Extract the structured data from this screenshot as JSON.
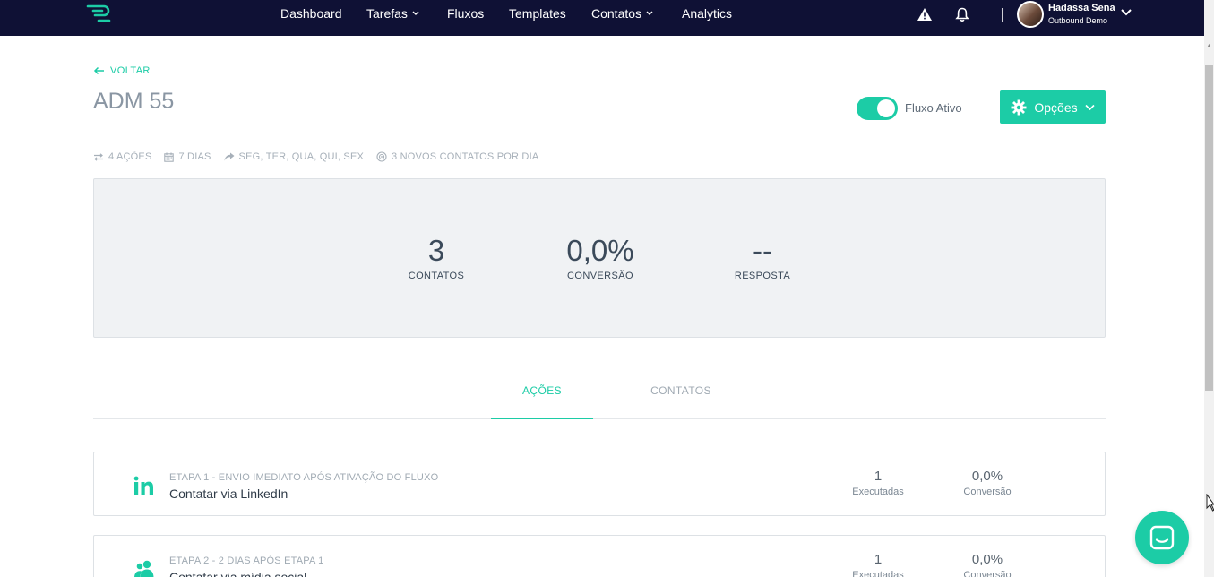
{
  "nav": {
    "items": [
      {
        "label": "Dashboard",
        "has_dropdown": false
      },
      {
        "label": "Tarefas",
        "has_dropdown": true
      },
      {
        "label": "Fluxos",
        "has_dropdown": false
      },
      {
        "label": "Templates",
        "has_dropdown": false
      },
      {
        "label": "Contatos",
        "has_dropdown": true
      },
      {
        "label": "Analytics",
        "has_dropdown": false
      }
    ],
    "icons": [
      "warning-icon",
      "bell-icon"
    ],
    "user": {
      "name": "Hadassa Sena",
      "org": "Outbound Demo"
    }
  },
  "header": {
    "back_label": "VOLTAR",
    "title": "ADM 55",
    "toggle_label": "Fluxo Ativo",
    "toggle_on": true,
    "options_label": "Opções"
  },
  "meta": {
    "actions": "4 AÇÕES",
    "days": "7 DIAS",
    "weekdays": "SEG, TER, QUA, QUI, SEX",
    "daily_contacts": "3 NOVOS CONTATOS POR DIA"
  },
  "stats": [
    {
      "value": "3",
      "label": "CONTATOS"
    },
    {
      "value": "0,0%",
      "label": "CONVERSÃO"
    },
    {
      "value": "--",
      "label": "RESPOSTA"
    }
  ],
  "tabs": [
    {
      "label": "AÇÕES",
      "active": true
    },
    {
      "label": "CONTATOS",
      "active": false
    }
  ],
  "actions": [
    {
      "icon": "linkedin-icon",
      "step": "ETAPA 1 - ENVIO IMEDIATO APÓS ATIVAÇÃO DO FLUXO",
      "title": "Contatar via LinkedIn",
      "executed_value": "1",
      "executed_label": "Executadas",
      "conversion_value": "0,0%",
      "conversion_label": "Conversão"
    },
    {
      "icon": "users-icon",
      "step": "ETAPA 2 - 2 DIAS APÓS ETAPA 1",
      "title": "Contatar via mídia social",
      "executed_value": "1",
      "executed_label": "Executadas",
      "conversion_value": "0,0%",
      "conversion_label": "Conversão"
    }
  ],
  "colors": {
    "accent": "#1ccca6",
    "nav_bg": "#0f1135",
    "panel_bg": "#f0f2f4"
  }
}
